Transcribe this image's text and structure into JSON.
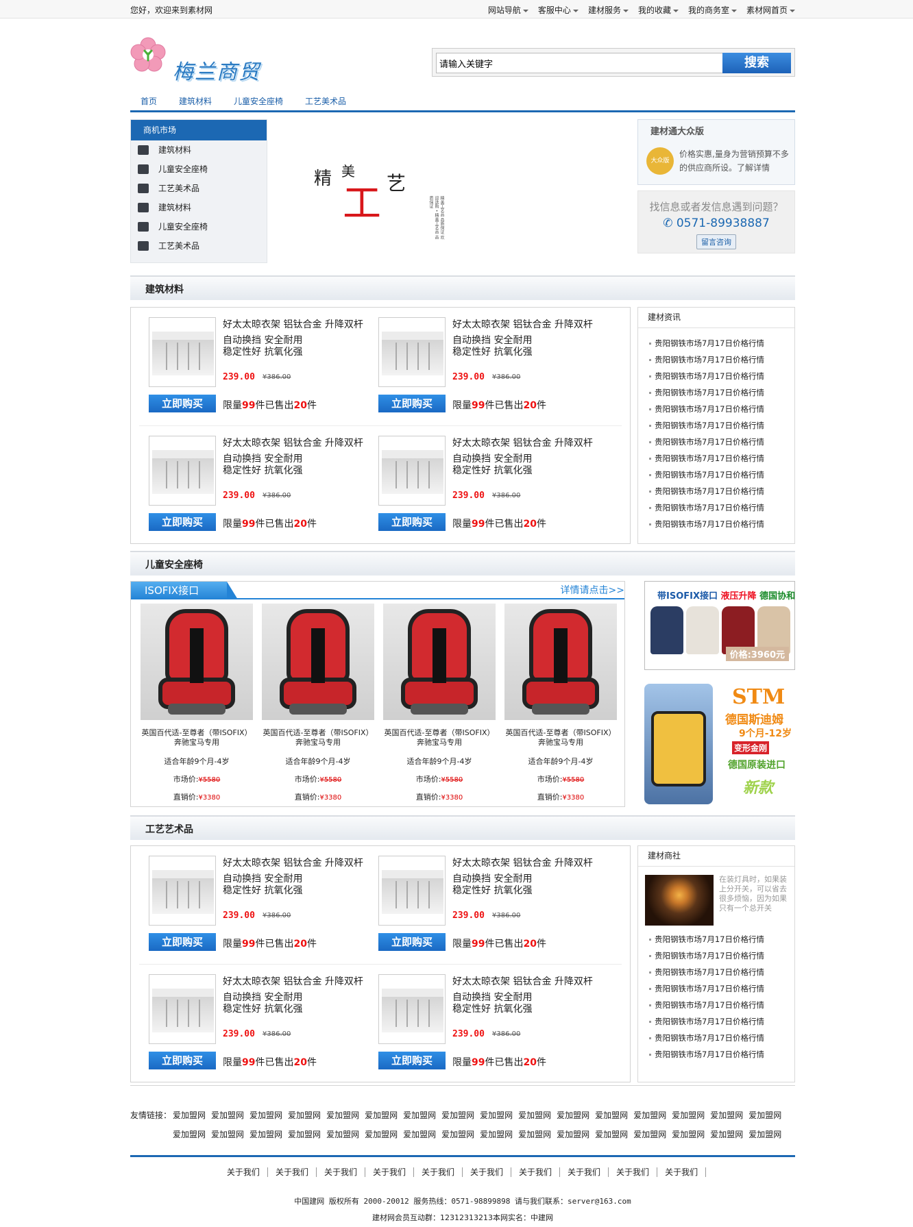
{
  "topbar": {
    "welcome": "您好，欢迎来到素材网",
    "nav": [
      "网站导航",
      "客服中心",
      "建材服务",
      "我的收藏",
      "我的商务室",
      "素材网首页"
    ]
  },
  "logo": {
    "text": "梅兰商贸"
  },
  "search": {
    "placeholder": "请输入关键字",
    "button": "搜索"
  },
  "mainnav": [
    "首页",
    "建筑材料",
    "儿童安全座椅",
    "工艺美术品"
  ],
  "sidemenu": {
    "title": "商机市场",
    "items": [
      {
        "label": "建筑材料",
        "icon": "cart-icon"
      },
      {
        "label": "儿童安全座椅",
        "icon": "printer-icon"
      },
      {
        "label": "工艺美术品",
        "icon": "users-icon"
      },
      {
        "label": "建筑材料",
        "icon": "tools-icon"
      },
      {
        "label": "儿童安全座椅",
        "icon": "blogger-icon"
      },
      {
        "label": "工艺美术品",
        "icon": "bank-icon"
      }
    ]
  },
  "banner": {
    "c1": "精",
    "c2": "美",
    "c3": "工",
    "c4": "艺",
    "small": "精美工艺品 品质保证 欢迎选购 • 精美工艺品 品质保证"
  },
  "promo": {
    "title": "建材通大众版",
    "badge": "大众版",
    "text": "价格实惠,量身为营销预算不多的供应商所设。了解详情"
  },
  "help": {
    "question": "找信息或者发信息遇到问题？",
    "phone": "0571-89938887",
    "button": "留言咨询"
  },
  "sections": {
    "building": "建筑材料",
    "child": "儿童安全座椅",
    "craft": "工艺艺术品"
  },
  "product": {
    "title": "好太太晾衣架 铝钛合金 升降双杆",
    "features": "自动换挡 安全耐用\n稳定性好 抗氧化强",
    "price": "239.00",
    "old_price": "¥386.00",
    "buy": "立即购买",
    "limit_pre": "限量",
    "limit_num": "99",
    "limit_mid": "件已售出",
    "sold_num": "20",
    "limit_post": "件"
  },
  "news1": {
    "title": "建材资讯",
    "items": [
      "贵阳钢铁市场7月17日价格行情",
      "贵阳钢铁市场7月17日价格行情",
      "贵阳钢铁市场7月17日价格行情",
      "贵阳钢铁市场7月17日价格行情",
      "贵阳钢铁市场7月17日价格行情",
      "贵阳钢铁市场7月17日价格行情",
      "贵阳钢铁市场7月17日价格行情",
      "贵阳钢铁市场7月17日价格行情",
      "贵阳钢铁市场7月17日价格行情",
      "贵阳钢铁市场7月17日价格行情",
      "贵阳钢铁市场7月17日价格行情",
      "贵阳钢铁市场7月17日价格行情"
    ]
  },
  "child": {
    "tab": "ISOFIX接口",
    "more": "详情请点击>>",
    "seat": {
      "name": "英国百代适-至尊者（带ISOFIX）奔驰宝马专用",
      "age": "适合年龄9个月-4岁",
      "market_label": "市场价:",
      "market_price": "¥5580",
      "sale_label": "直销价:",
      "sale_price": "¥3380"
    }
  },
  "ad1": {
    "a": "带ISOFIX接口",
    "b": "液压升降",
    "c": "德国协和",
    "price": "价格:3960元"
  },
  "ad2": {
    "brand": "STM",
    "line1": "德国斯迪姆",
    "line2": "9个月-12岁",
    "line3": "变形金刚",
    "line4": "德国原装进口",
    "line5": "新款"
  },
  "news2": {
    "title": "建材商社",
    "feature_text": "在装灯具时，如果装上分开关，可以省去很多烦恼，因为如果只有一个总开关",
    "items": [
      "贵阳钢铁市场7月17日价格行情",
      "贵阳钢铁市场7月17日价格行情",
      "贵阳钢铁市场7月17日价格行情",
      "贵阳钢铁市场7月17日价格行情",
      "贵阳钢铁市场7月17日价格行情",
      "贵阳钢铁市场7月17日价格行情",
      "贵阳钢铁市场7月17日价格行情",
      "贵阳钢铁市场7月17日价格行情"
    ]
  },
  "links": {
    "label": "友情链接：",
    "items": [
      "爱加盟网",
      "爱加盟网",
      "爱加盟网",
      "爱加盟网",
      "爱加盟网",
      "爱加盟网",
      "爱加盟网",
      "爱加盟网",
      "爱加盟网",
      "爱加盟网",
      "爱加盟网",
      "爱加盟网",
      "爱加盟网",
      "爱加盟网",
      "爱加盟网",
      "爱加盟网",
      "爱加盟网",
      "爱加盟网",
      "爱加盟网",
      "爱加盟网",
      "爱加盟网",
      "爱加盟网",
      "爱加盟网",
      "爱加盟网",
      "爱加盟网",
      "爱加盟网",
      "爱加盟网",
      "爱加盟网",
      "爱加盟网",
      "爱加盟网",
      "爱加盟网",
      "爱加盟网"
    ]
  },
  "footer": {
    "nav": [
      "关于我们",
      "关于我们",
      "关于我们",
      "关于我们",
      "关于我们",
      "关于我们",
      "关于我们",
      "关于我们",
      "关于我们",
      "关于我们"
    ],
    "copy1": "中国建网 版权所有 2000-20012 服务热线：0571-98899898 请与我们联系：server@163.com",
    "copy2": "建材网会员互动群：12312313213本网实名：中建网"
  }
}
